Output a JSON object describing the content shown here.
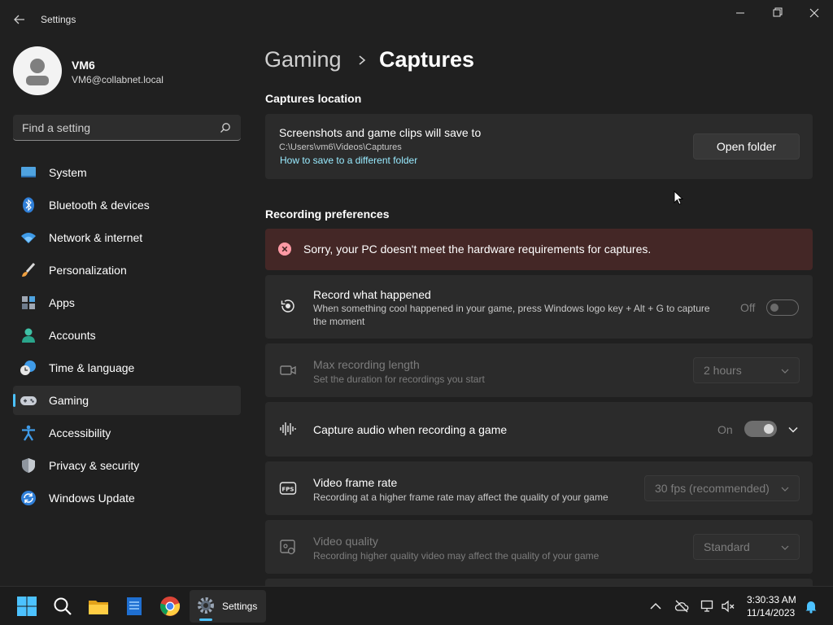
{
  "window": {
    "title": "Settings"
  },
  "user": {
    "name": "VM6",
    "email": "VM6@collabnet.local"
  },
  "search": {
    "placeholder": "Find a setting"
  },
  "sidebar": {
    "items": [
      {
        "label": "System",
        "icon": "system-icon"
      },
      {
        "label": "Bluetooth & devices",
        "icon": "bluetooth-icon"
      },
      {
        "label": "Network & internet",
        "icon": "wifi-icon"
      },
      {
        "label": "Personalization",
        "icon": "brush-icon"
      },
      {
        "label": "Apps",
        "icon": "apps-icon"
      },
      {
        "label": "Accounts",
        "icon": "person-icon"
      },
      {
        "label": "Time & language",
        "icon": "clock-globe-icon"
      },
      {
        "label": "Gaming",
        "icon": "gamepad-icon",
        "active": true
      },
      {
        "label": "Accessibility",
        "icon": "accessibility-icon"
      },
      {
        "label": "Privacy & security",
        "icon": "shield-icon"
      },
      {
        "label": "Windows Update",
        "icon": "update-icon"
      }
    ]
  },
  "breadcrumb": {
    "parent": "Gaming",
    "current": "Captures"
  },
  "captures_location": {
    "section_title": "Captures location",
    "title": "Screenshots and game clips will save to",
    "path": "C:\\Users\\vm6\\Videos\\Captures",
    "link": "How to save to a different folder",
    "button": "Open folder"
  },
  "recording": {
    "section_title": "Recording preferences",
    "error": "Sorry, your PC doesn't meet the hardware requirements for captures.",
    "record_what_happened": {
      "title": "Record what happened",
      "desc_line1": "When something cool happened in your game, press Windows logo key + Alt + G to capture",
      "desc_line2": "the moment",
      "state": "Off"
    },
    "max_length": {
      "title": "Max recording length",
      "desc": "Set the duration for recordings you start",
      "value": "2 hours"
    },
    "capture_audio": {
      "title": "Capture audio when recording a game",
      "state": "On"
    },
    "frame_rate": {
      "title": "Video frame rate",
      "desc": "Recording at a higher frame rate may affect the quality of your game",
      "value": "30 fps (recommended)"
    },
    "video_quality": {
      "title": "Video quality",
      "desc": "Recording higher quality video may affect the quality of your game",
      "value": "Standard"
    }
  },
  "taskbar": {
    "active_app_label": "Settings",
    "time": "3:30:33 AM",
    "date": "11/14/2023"
  },
  "colors": {
    "accent": "#4cc2ff",
    "background": "#202020",
    "card": "#2b2b2b",
    "error_bg": "#442726",
    "link": "#99ebff"
  }
}
